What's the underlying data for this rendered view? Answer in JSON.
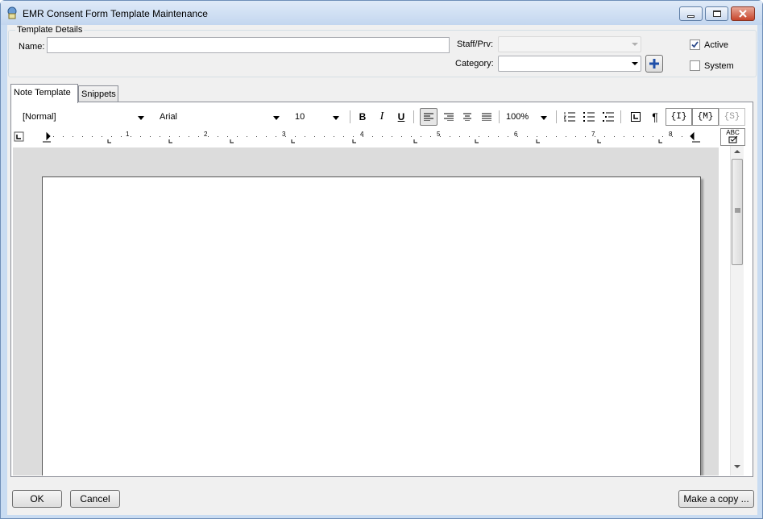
{
  "window": {
    "title": "EMR Consent Form Template Maintenance"
  },
  "template_details": {
    "legend": "Template Details",
    "name_label": "Name:",
    "name_value": "",
    "staff_label": "Staff/Prv:",
    "staff_value": "",
    "category_label": "Category:",
    "category_value": "",
    "active_label": "Active",
    "active_checked": true,
    "system_label": "System",
    "system_checked": false
  },
  "tabs": [
    {
      "label": "Note Template",
      "active": true
    },
    {
      "label": "Snippets",
      "active": false
    }
  ],
  "editor": {
    "style_value": "[Normal]",
    "font_value": "Arial",
    "size_value": "10",
    "zoom_value": "100%",
    "field_buttons": [
      "{I}",
      "{M}",
      "{S}"
    ],
    "spell_label": "ABC",
    "ruler_numbers": [
      "1",
      "2",
      "3",
      "4",
      "5",
      "6",
      "7",
      "8"
    ]
  },
  "footer": {
    "ok_label": "OK",
    "cancel_label": "Cancel",
    "copy_label": "Make a copy ..."
  }
}
